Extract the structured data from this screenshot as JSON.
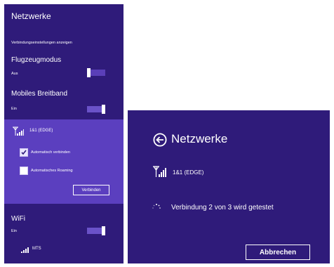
{
  "left_panel": {
    "title": "Netzwerke",
    "show_connection_settings": "Verbindungseinstellungen anzeigen",
    "airplane": {
      "label": "Flugzeugmodus",
      "state": "Aus"
    },
    "mobile_broadband": {
      "label": "Mobiles Breitband",
      "state": "Ein"
    },
    "network": {
      "name": "1&1 (EDGE)",
      "auto_connect": {
        "label": "Automatisch verbinden",
        "checked": true
      },
      "auto_roaming": {
        "label": "Automatisches Roaming",
        "checked": false
      },
      "connect_button": "Verbinden"
    },
    "wifi": {
      "label": "WiFi",
      "state": "Ein",
      "network_name": "MTS"
    }
  },
  "right_panel": {
    "title": "Netzwerke",
    "network_name": "1&1 (EDGE)",
    "status": "Verbindung 2 von 3 wird getestet",
    "cancel_button": "Abbrechen"
  },
  "colors": {
    "panel_bg": "#2f1b7a",
    "highlight_bg": "#5b3fbf",
    "accent": "#ffffff"
  },
  "icons": [
    "signal-bars-icon",
    "back-arrow-icon",
    "spinner-icon",
    "checkbox-check-icon"
  ]
}
